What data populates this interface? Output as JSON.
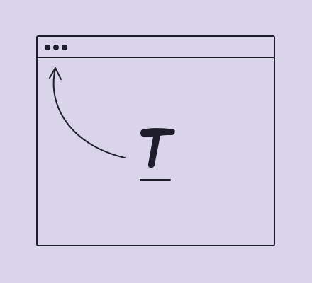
{
  "colors": {
    "background": "#d9d4e9",
    "stroke": "#1f1d2b",
    "window_fill": "#d9d4e9"
  },
  "window": {
    "titlebar_controls": [
      "window-dot",
      "window-dot",
      "window-dot"
    ]
  },
  "illustration": {
    "icon": "text-cursor-T-icon",
    "arrow": "curved-arrow-pointing-to-top-left-icon"
  }
}
